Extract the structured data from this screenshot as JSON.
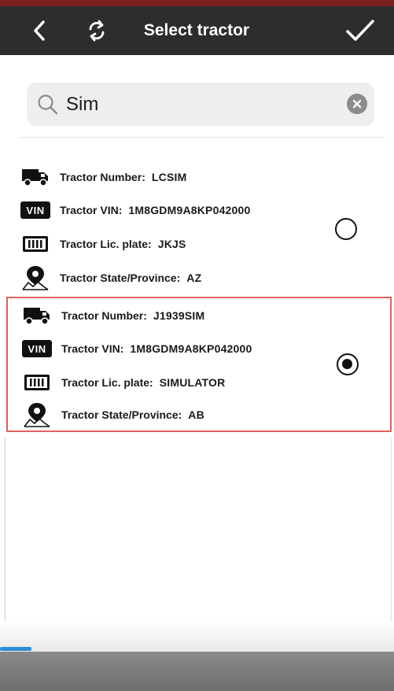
{
  "navbar": {
    "title": "Select tractor",
    "back_icon": "chevron-left-icon",
    "refresh_icon": "refresh-icon",
    "confirm_icon": "checkmark-icon",
    "background": "#2d2d2d"
  },
  "search": {
    "value": "Sim",
    "placeholder": "",
    "search_icon": "search-icon",
    "clear_icon": "clear-icon"
  },
  "tractors": [
    {
      "number_label": "Tractor Number:",
      "number": "LCSIM",
      "vin_label": "Tractor VIN:",
      "vin": "1M8GDM9A8KP042000",
      "plate_label": "Tractor Lic. plate:",
      "plate": "JKJS",
      "state_label": "Tractor State/Province:",
      "state": "AZ",
      "selected": false
    },
    {
      "number_label": "Tractor Number:",
      "number": "J1939SIM",
      "vin_label": "Tractor VIN:",
      "vin": "1M8GDM9A8KP042000",
      "plate_label": "Tractor Lic. plate:",
      "plate": "SIMULATOR",
      "state_label": "Tractor State/Province:",
      "state": "AB",
      "selected": true
    }
  ],
  "icons": {
    "vin_badge": "VIN",
    "truck": "truck-icon",
    "plate": "license-plate-icon",
    "location": "map-pin-icon"
  },
  "colors": {
    "selection_border": "#e06060",
    "progress": "#2a8fd8"
  }
}
